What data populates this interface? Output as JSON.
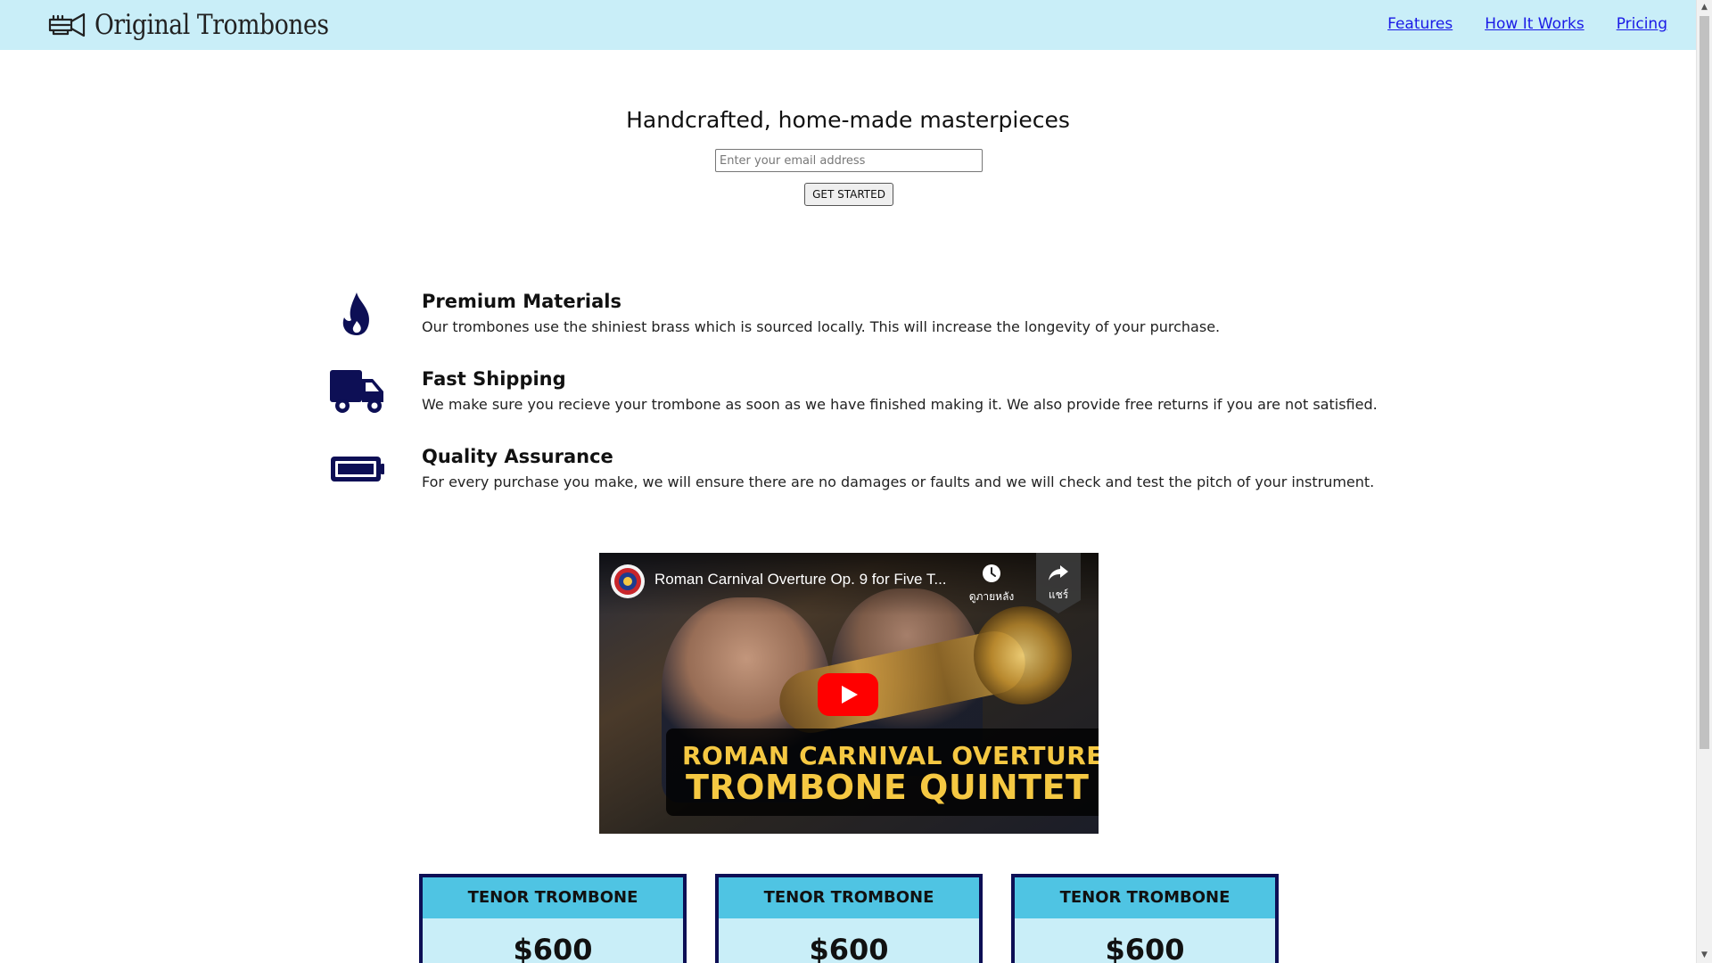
{
  "header": {
    "brand": "Original Trombones",
    "nav": [
      {
        "label": "Features"
      },
      {
        "label": "How It Works"
      },
      {
        "label": "Pricing"
      }
    ]
  },
  "hero": {
    "title": "Handcrafted, home-made masterpieces",
    "email_placeholder": "Enter your email address",
    "email_value": "",
    "cta_label": "GET STARTED"
  },
  "features": [
    {
      "icon": "fire-icon",
      "title": "Premium Materials",
      "description": "Our trombones use the shiniest brass which is sourced locally. This will increase the longevity of your purchase."
    },
    {
      "icon": "truck-icon",
      "title": "Fast Shipping",
      "description": "We make sure you recieve your trombone as soon as we have finished making it. We also provide free returns if you are not satisfied."
    },
    {
      "icon": "battery-icon",
      "title": "Quality Assurance",
      "description": "For every purchase you make, we will ensure there are no damages or faults and we will check and test the pitch of your instrument."
    }
  ],
  "video": {
    "title": "Roman Carnival Overture Op. 9 for Five T...",
    "watch_later_label": "ดูภายหลัง",
    "share_label": "แชร์",
    "banner_line1": "ROMAN CARNIVAL OVERTURE",
    "banner_line2": "TROMBONE QUINTET"
  },
  "pricing": [
    {
      "name": "TENOR TROMBONE",
      "price": "$600"
    },
    {
      "name": "TENOR TROMBONE",
      "price": "$600"
    },
    {
      "name": "TENOR TROMBONE",
      "price": "$600"
    }
  ],
  "colors": {
    "header_bg": "#c9eef8",
    "icon_navy": "#0d0f55",
    "link": "#1a1ae6",
    "card_header": "#4fc4e3",
    "card_body": "#c9eef8",
    "banner_text": "#f5c842",
    "youtube_red": "#ff0000"
  }
}
